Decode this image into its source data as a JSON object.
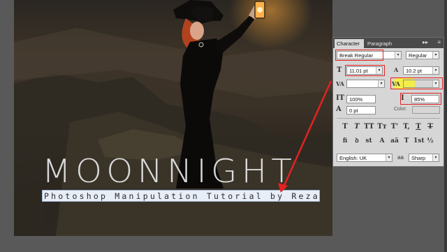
{
  "canvas": {
    "title": "MOONNIGHT",
    "subtitle": "Photoshop Manipulation Tutorial by Reza"
  },
  "panel": {
    "tabs": [
      {
        "label": "Character",
        "active": true
      },
      {
        "label": "Paragraph",
        "active": false
      }
    ],
    "font_family": "Break Regular",
    "font_style": "Regular",
    "font_size": "11.01 pt",
    "leading": "10.2 pt",
    "kerning": "",
    "tracking": "",
    "vertical_scale": "100%",
    "horizontal_scale": "85%",
    "baseline_shift": "0 pt",
    "color_label": "Color:",
    "typo_buttons": [
      "T",
      "T",
      "TT",
      "Tт",
      "T'",
      "T,",
      "T",
      "T"
    ],
    "opentype_buttons": [
      "fi",
      "ꝺ",
      "st",
      "A",
      "aā",
      "T",
      "1st",
      "½"
    ],
    "language": "English: UK",
    "aa_label": "aa",
    "antialias": "Sharp",
    "accent_color": "#e32222",
    "highlight_color": "#f6f03a"
  }
}
